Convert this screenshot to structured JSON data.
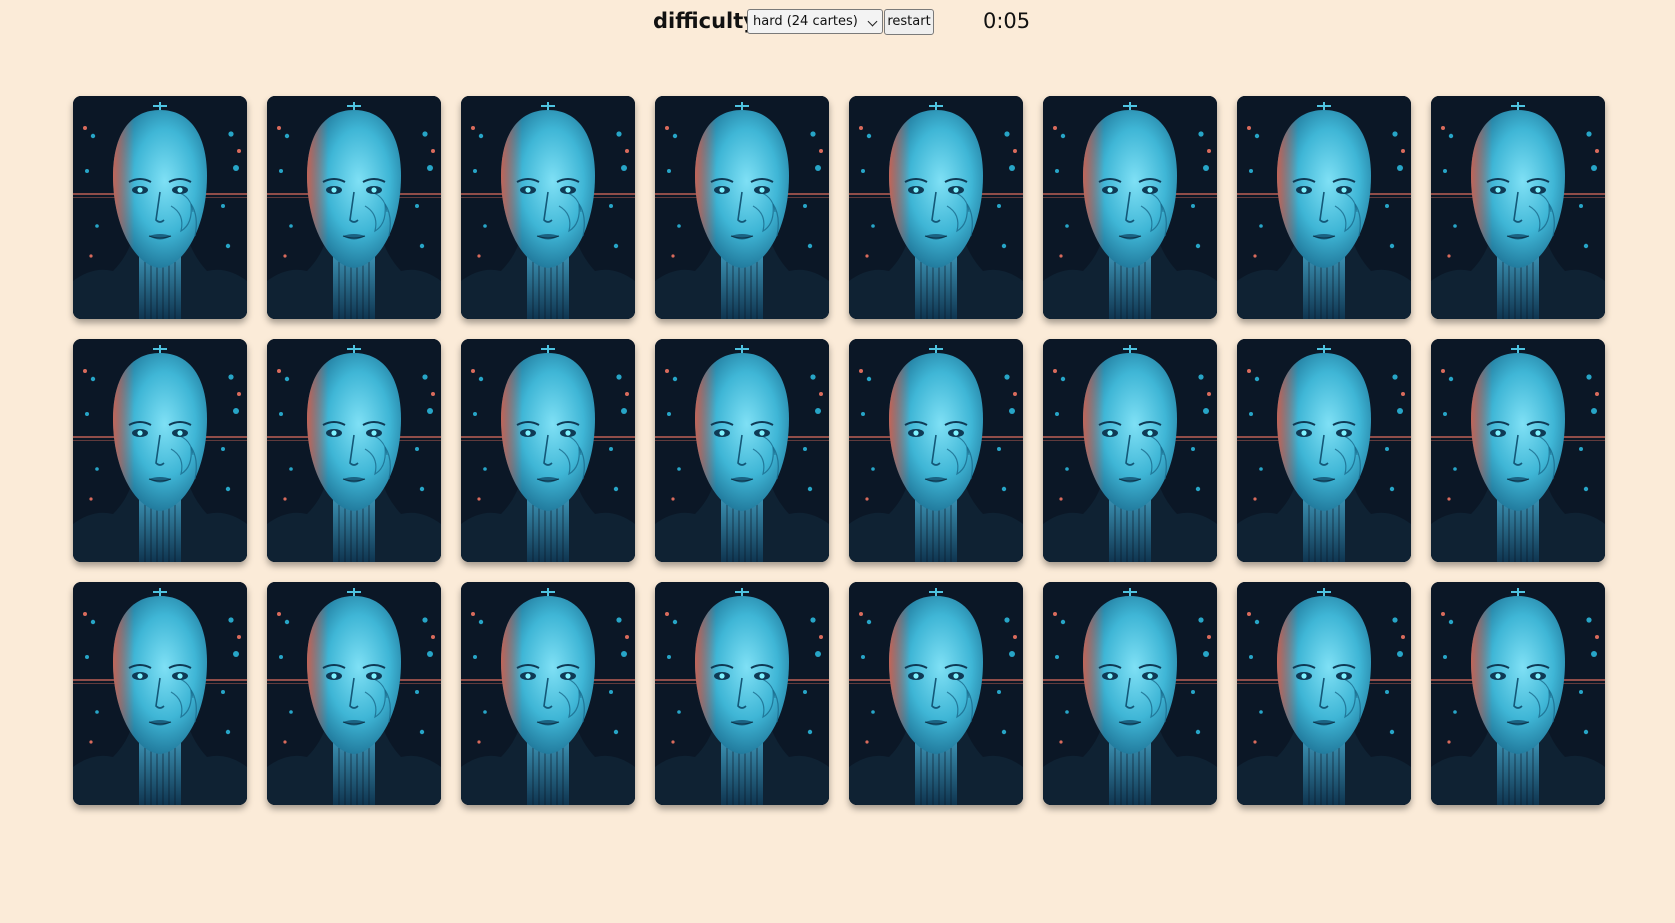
{
  "toolbar": {
    "difficulty_label": "difficulty",
    "difficulty_selected": "hard (24 cartes)",
    "restart_label": "restart",
    "timer": "0:05"
  },
  "board": {
    "rows": 3,
    "columns": 8,
    "card_count": 24,
    "card_back_icon": "robot-face-icon",
    "colors": {
      "background": "#fbebd8",
      "card_dark": "#0a1624",
      "face_cyan": "#3fb6d6",
      "accent_red": "#e0604a"
    }
  }
}
